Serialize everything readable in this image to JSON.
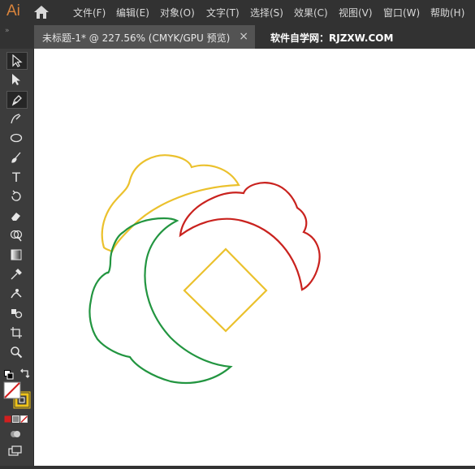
{
  "app": {
    "logo": "Ai"
  },
  "menu": [
    "文件(F)",
    "编辑(E)",
    "对象(O)",
    "文字(T)",
    "选择(S)",
    "效果(C)",
    "视图(V)",
    "窗口(W)",
    "帮助(H)"
  ],
  "document": {
    "tab_title": "未标题-1* @ 227.56% (CMYK/GPU 预览)",
    "close_glyph": "×"
  },
  "watermark": "软件自学网：RJZXW.COM",
  "toolbar": {
    "collapse_glyph": "»",
    "tools": [
      "selection-tool",
      "direct-selection-tool",
      "pen-tool",
      "curvature-tool",
      "ellipse-tool",
      "paintbrush-tool",
      "type-tool",
      "rotate-tool",
      "eraser-tool",
      "shape-builder-tool",
      "gradient-tool",
      "eyedropper-tool",
      "puppet-warp-tool",
      "symbol-tool",
      "artboard-tool",
      "zoom-tool"
    ],
    "type_glyph": "T"
  },
  "colors": {
    "fill": "#ffffff",
    "stroke": "#f0c419",
    "yellow": "#ebc12d",
    "red": "#c9221e",
    "green": "#229540",
    "accent": "#d9843c"
  }
}
